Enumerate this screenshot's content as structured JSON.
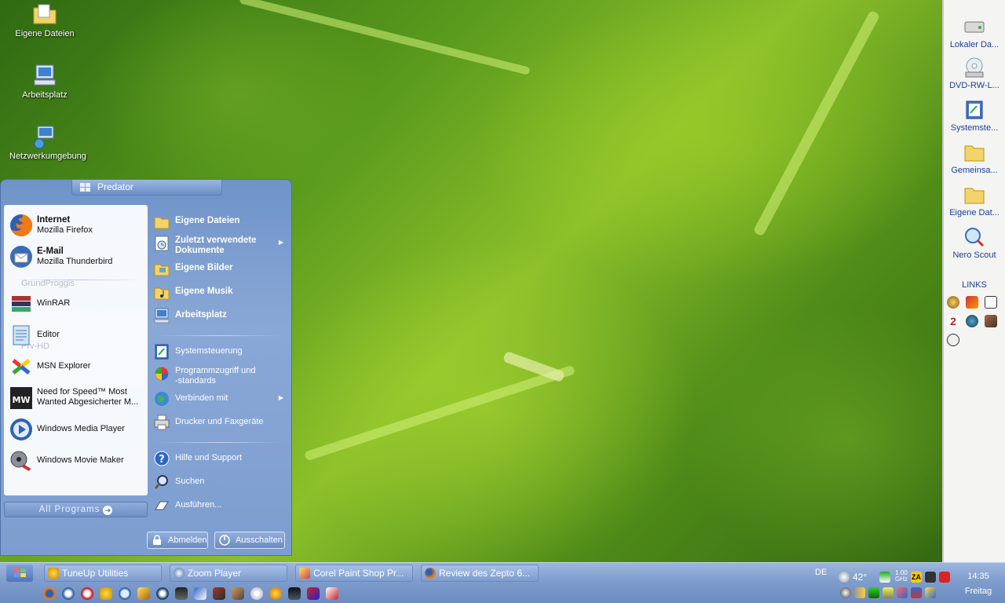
{
  "desktop": {
    "icons": [
      {
        "label": "Eigene Dateien",
        "icon": "folder-documents-icon"
      },
      {
        "label": "Arbeitsplatz",
        "icon": "my-computer-icon"
      },
      {
        "label": "Netzwerkumgebung",
        "icon": "network-icon"
      }
    ]
  },
  "sidebar": {
    "items": [
      {
        "label": "Lokaler Da...",
        "icon": "hard-drive-icon"
      },
      {
        "label": "DVD-RW-L...",
        "icon": "dvd-drive-icon"
      },
      {
        "label": "Systemste...",
        "icon": "control-panel-icon"
      },
      {
        "label": "Gemeinsa...",
        "icon": "shared-folder-icon"
      },
      {
        "label": "Eigene Dat...",
        "icon": "documents-folder-icon"
      },
      {
        "label": "Nero Scout",
        "icon": "nero-scout-icon"
      }
    ],
    "links_title": "LINKS"
  },
  "start_menu": {
    "user": "Predator",
    "pinned": [
      {
        "title": "Internet",
        "subtitle": "Mozilla Firefox",
        "icon": "firefox-icon"
      },
      {
        "title": "E-Mail",
        "subtitle": "Mozilla Thunderbird",
        "icon": "thunderbird-icon"
      }
    ],
    "ghost_labels": [
      "GrundProggis",
      "Prv-HD"
    ],
    "recent": [
      {
        "label": "WinRAR",
        "icon": "winrar-icon"
      },
      {
        "label": "Editor",
        "icon": "notepad-icon"
      },
      {
        "label": "MSN Explorer",
        "icon": "msn-icon"
      },
      {
        "label1": "Need for Speed™ Most",
        "label2": "Wanted Abgesicherter M...",
        "icon": "nfs-icon"
      },
      {
        "label": "Windows Media Player",
        "icon": "media-player-icon"
      },
      {
        "label": "Windows Movie Maker",
        "icon": "movie-maker-icon"
      }
    ],
    "all_programs": "All Programs",
    "right_top": [
      {
        "label": "Eigene Dateien",
        "icon": "folder-documents-icon"
      },
      {
        "label1": "Zuletzt verwendete",
        "label2": "Dokumente",
        "icon": "recent-docs-icon"
      },
      {
        "label": "Eigene Bilder",
        "icon": "pictures-folder-icon"
      },
      {
        "label": "Eigene Musik",
        "icon": "music-folder-icon"
      },
      {
        "label": "Arbeitsplatz",
        "icon": "my-computer-icon"
      }
    ],
    "right_mid": [
      {
        "label": "Systemsteuerung",
        "icon": "control-panel-icon"
      },
      {
        "label1": "Programmzugriff und",
        "label2": "-standards",
        "icon": "program-access-icon"
      },
      {
        "label": "Verbinden mit",
        "icon": "connect-icon"
      },
      {
        "label": "Drucker und Faxgeräte",
        "icon": "printer-icon"
      }
    ],
    "right_bottom": [
      {
        "label": "Hilfe und Support",
        "icon": "help-icon"
      },
      {
        "label": "Suchen",
        "icon": "search-icon"
      },
      {
        "label": "Ausführen...",
        "icon": "run-icon"
      }
    ],
    "logoff": "Abmelden",
    "shutdown": "Ausschalten"
  },
  "taskbar": {
    "tasks": [
      {
        "label": "TuneUp Utilities",
        "icon": "tuneup-icon"
      },
      {
        "label": "Zoom Player",
        "icon": "zoom-player-icon"
      },
      {
        "label": "Corel Paint Shop Pr...",
        "icon": "paintshop-icon"
      },
      {
        "label": "Review des Zepto 6...",
        "icon": "firefox-icon"
      }
    ],
    "language": "DE",
    "temperature": "42°",
    "cpu_line1": "1.00",
    "cpu_line2": "GHz",
    "time": "14:35",
    "day": "Freitag"
  },
  "colors": {
    "start_menu_blue": "#7d9dd0",
    "taskbar_blue": "#7f9dcc",
    "sidebar_text": "#1a3f9a"
  }
}
